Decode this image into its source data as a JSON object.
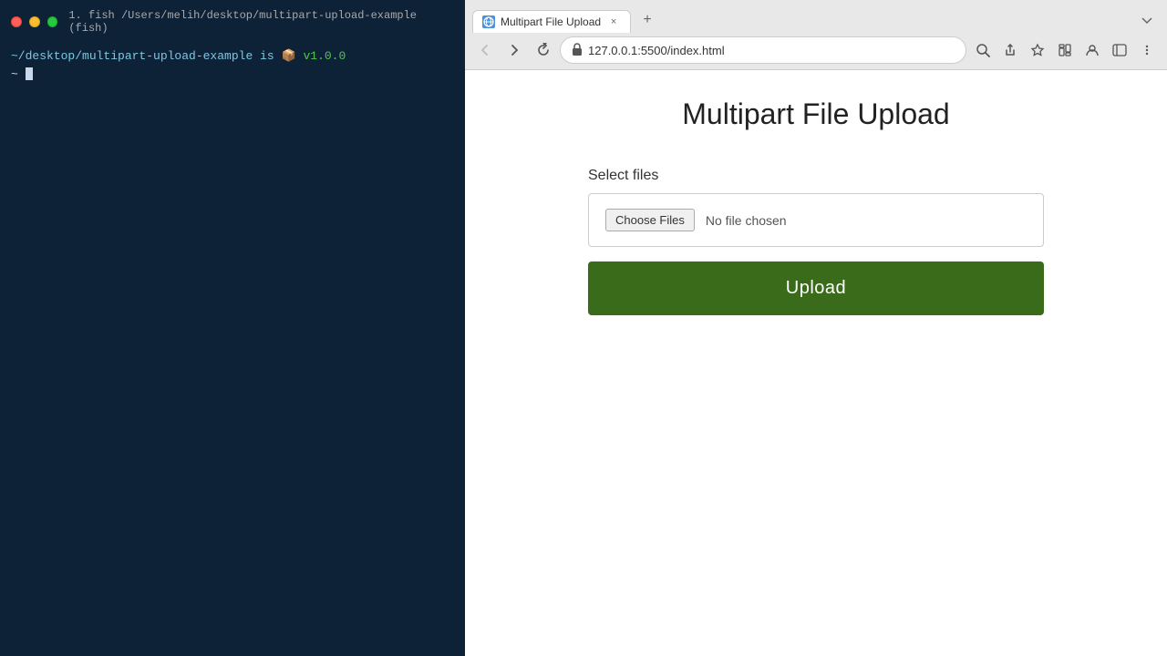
{
  "terminal": {
    "title": "1. fish /Users/melih/desktop/multipart-upload-example (fish)",
    "prompt_line": "~/desktop/multipart-upload-example is",
    "version_badge": "📦",
    "version": "v1.0.0",
    "cursor_visible": true
  },
  "browser": {
    "tab": {
      "favicon_text": "🌐",
      "title": "Multipart File Upload",
      "close_label": "×"
    },
    "new_tab_label": "+",
    "tab_menu_label": "⌄",
    "toolbar": {
      "back_label": "←",
      "forward_label": "→",
      "reload_label": "↻",
      "address": "127.0.0.1:5500/index.html",
      "zoom_label": "🔍",
      "share_label": "⬆",
      "bookmark_label": "☆",
      "profile_label": "👤",
      "sidebar_label": "▣",
      "extensions_label": "🧩",
      "menu_label": "⋮"
    },
    "page": {
      "title": "Multipart File Upload",
      "form": {
        "label": "Select files",
        "choose_files_btn": "Choose Files",
        "no_file_text": "No file chosen",
        "upload_btn": "Upload"
      }
    }
  },
  "colors": {
    "upload_btn_bg": "#3a6b1a",
    "terminal_bg": "#0d2137"
  }
}
